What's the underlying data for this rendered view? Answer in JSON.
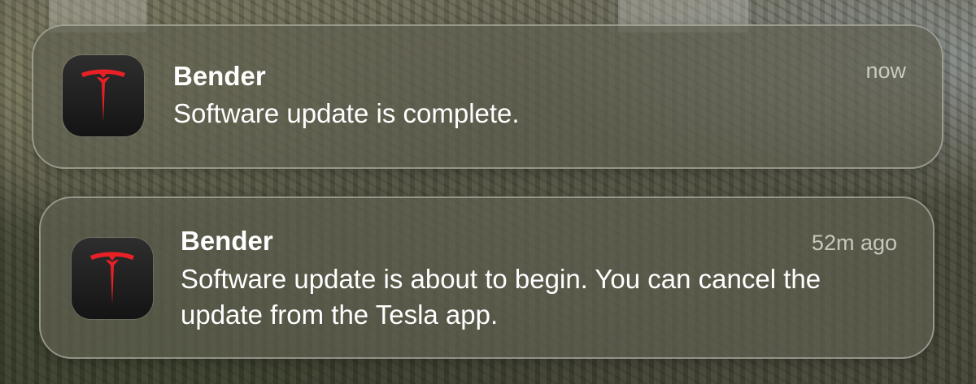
{
  "notifications": [
    {
      "app_icon": "tesla-logo-icon",
      "title": "Bender",
      "message": "Software update is complete.",
      "time": "now"
    },
    {
      "app_icon": "tesla-logo-icon",
      "title": "Bender",
      "message": "Software update is about to begin. You can cancel the update from the Tesla app.",
      "time": "52m ago"
    }
  ],
  "colors": {
    "tesla_red": "#e82127",
    "icon_background": "#1e1e1e"
  }
}
